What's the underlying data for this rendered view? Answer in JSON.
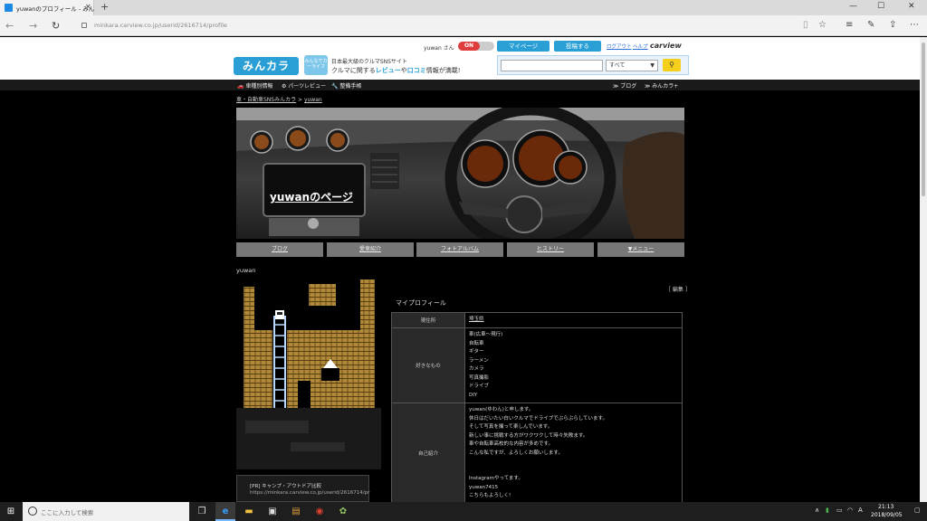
{
  "browser": {
    "tab_title": "yuwanのプロフィール - みん",
    "url": "minkara.carview.co.jp/userid/2616714/profile"
  },
  "site": {
    "logo": "みんカラ",
    "badge": "みんなでカーライフ",
    "tagline_line1": "日本最大級のクルマSNSサイト",
    "tagline_pre": "クルマに関する",
    "tagline_review": "レビュー",
    "tagline_mid": "や",
    "tagline_kuchikomi": "口コミ",
    "tagline_post": "情報が満載!",
    "user_name": "yuwan さん",
    "toggle_label": "ON",
    "mypage_label": "マイページ",
    "post_label": "投稿する",
    "logout_label": "ログアウト",
    "help_label": "ヘルプ",
    "carview": "carview",
    "search_placeholder": "",
    "search_category": "すべて"
  },
  "global_nav": [
    "🚗 車種別情報",
    "⚙ パーツレビュー",
    "🔧 整備手帳",
    "≫ ブログ",
    "≫ みんカラ+"
  ],
  "breadcrumb": {
    "home": "車・自動車SNSみんカラ",
    "sep": " > ",
    "current": "yuwan"
  },
  "banner_title": "yuwanのページ",
  "profile_tabs": [
    "ブログ",
    "愛車紹介",
    "フォトアルバム",
    "ヒストリー",
    "▼メニュー"
  ],
  "profile_handle": "yuwan",
  "avatar_caption": {
    "line1": "[PR] キャンプ・アウトドア比較",
    "line2": "https://minkara.carview.co.jp/userid/2616714/pr"
  },
  "edit_link": "［ 編集 ］",
  "section_title": "マイプロフィール",
  "profile": {
    "residence_label": "現住所",
    "residence_value": "埼玉県",
    "likes_label": "好きなもの",
    "likes": [
      "車(広車～現行)",
      "自転車",
      "ギター",
      "ラーメン",
      "カメラ",
      "写真撮影",
      "ドライブ",
      "DIY"
    ],
    "intro_label": "自己紹介",
    "intro": [
      "yuwan(ゆわん)と申します。",
      "休日はだいたい白いクルマでドライブでぶらぶらしています。",
      "そして写真を撮って楽しんでいます。",
      "新しい事に挑戦する方がワクワクして時々失敗ます。",
      "車や自転車高校的な内容が多めです。",
      "こんな私ですが、よろしくお願いします。",
      "",
      "Instagramやってます。",
      "yuwan7415",
      "こちらもよろしく!"
    ]
  },
  "taskbar": {
    "search_placeholder": "ここに入力して検索",
    "tray_lang": "A",
    "time": "21:13",
    "date": "2018/09/05"
  }
}
